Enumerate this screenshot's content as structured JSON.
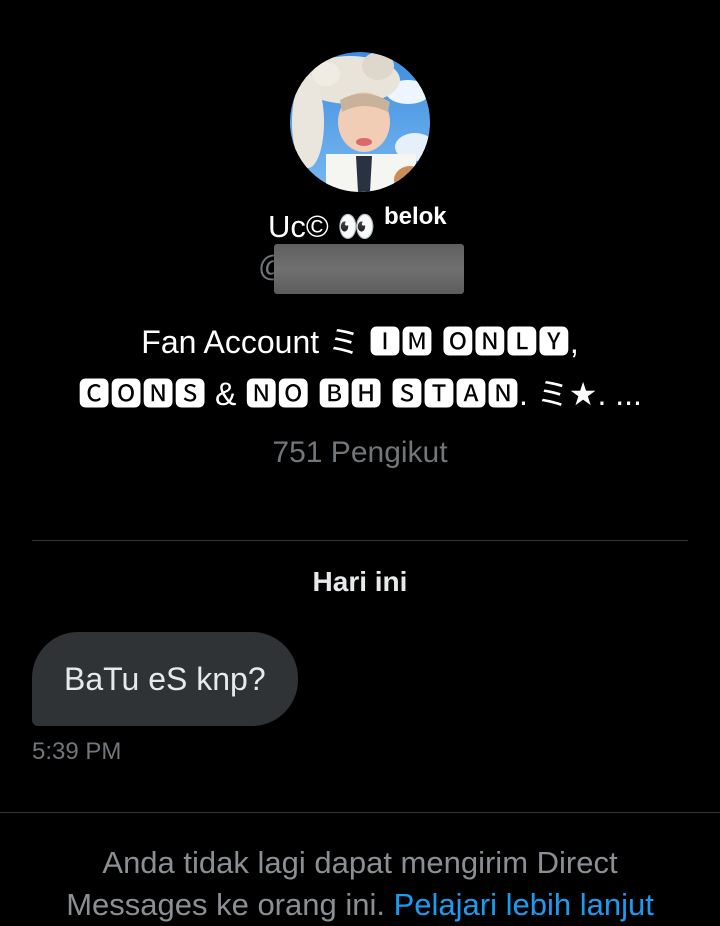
{
  "profile": {
    "display_name": "Uc© 👀",
    "name_suffix": "belok",
    "handle_prefix": "@",
    "bio_line1": "Fan Account ミ 🅸🅼 🅾🅽🅻🆈,",
    "bio_line2": "🅲🅾🅽🆂 & 🅽🅾 🅱🅷 🆂🆃🅰🅽. ミ★. ...",
    "followers": "751 Pengikut"
  },
  "conversation": {
    "date_label": "Hari ini",
    "messages": [
      {
        "text": "BaTu eS knp?",
        "time": "5:39 PM"
      }
    ]
  },
  "notice": {
    "line1": "Anda tidak lagi dapat mengirim Direct",
    "line2": "Messages ke orang ini.",
    "link": "Pelajari lebih lanjut"
  },
  "colors": {
    "background": "#000000",
    "bubble": "#2f3336",
    "muted": "#71767b",
    "link": "#1d9bf0",
    "divider": "#333639"
  }
}
